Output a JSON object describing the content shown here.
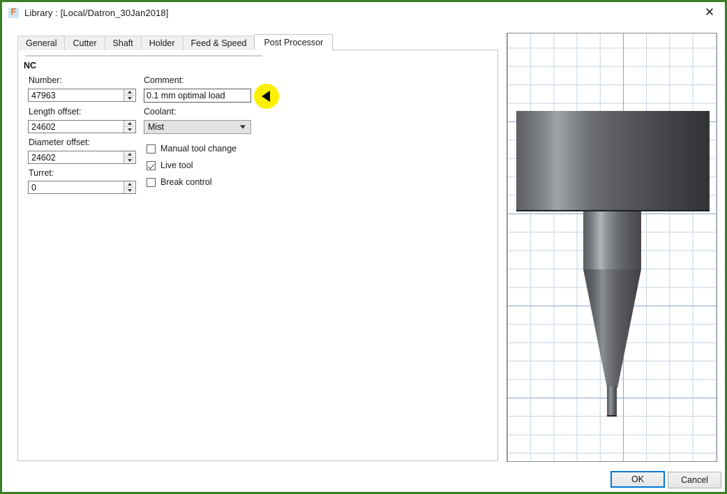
{
  "window": {
    "title": "Library :  [Local/Datron_30Jan2018]",
    "app_icon": "fusion-f-icon",
    "close_icon": "close-icon",
    "border_color": "#3a7d28"
  },
  "tabs": [
    {
      "label": "General",
      "active": false
    },
    {
      "label": "Cutter",
      "active": false
    },
    {
      "label": "Shaft",
      "active": false
    },
    {
      "label": "Holder",
      "active": false
    },
    {
      "label": "Feed & Speed",
      "active": false
    },
    {
      "label": "Post Processor",
      "active": true
    }
  ],
  "form": {
    "section_title": "NC",
    "number": {
      "label": "Number:",
      "value": "47963"
    },
    "length_offset": {
      "label": "Length offset:",
      "value": "24602"
    },
    "diameter_offset": {
      "label": "Diameter offset:",
      "value": "24602"
    },
    "turret": {
      "label": "Turret:",
      "value": "0"
    },
    "comment": {
      "label": "Comment:",
      "value": "0.1 mm optimal load",
      "placeholder": ""
    },
    "coolant": {
      "label": "Coolant:",
      "value": "Mist",
      "options": [
        "Mist"
      ]
    },
    "checkboxes": [
      {
        "label": "Manual tool change",
        "checked": false
      },
      {
        "label": "Live tool",
        "checked": true
      },
      {
        "label": "Break control",
        "checked": false
      }
    ]
  },
  "annotation": {
    "marker": "left-arrow-marker",
    "color": "#fbf000"
  },
  "preview": {
    "name": "tool-preview",
    "grid_color": "#c3d4e6",
    "grid_major_color": "#93a9c4",
    "parts": [
      "holder",
      "shank",
      "cone",
      "tip"
    ]
  },
  "footer": {
    "ok_label": "OK",
    "cancel_label": "Cancel",
    "accent_color": "#0078d7"
  }
}
